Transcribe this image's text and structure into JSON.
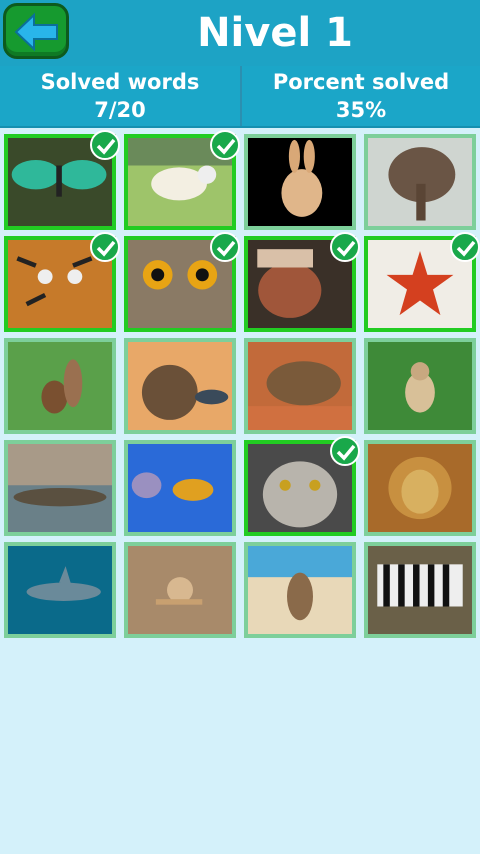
{
  "header": {
    "title": "Nivel 1",
    "back_icon": "arrow-left-icon"
  },
  "stats": {
    "solved_label": "Solved words",
    "solved_value": "7/20",
    "percent_label": "Porcent solved",
    "percent_value": "35%"
  },
  "colors": {
    "header_bg": "#1da3c5",
    "page_bg": "#d4f1fa",
    "solved_border": "#22cc22",
    "unsolved_border": "#7dcf9a",
    "check_bg": "#19a84a"
  },
  "tiles": [
    {
      "name": "butterfly",
      "solved": true
    },
    {
      "name": "sheep",
      "solved": true
    },
    {
      "name": "rabbit",
      "solved": false
    },
    {
      "name": "elephant",
      "solved": false
    },
    {
      "name": "tiger",
      "solved": true
    },
    {
      "name": "owl",
      "solved": true
    },
    {
      "name": "horse",
      "solved": true
    },
    {
      "name": "starfish",
      "solved": true
    },
    {
      "name": "squirrel",
      "solved": false
    },
    {
      "name": "duck",
      "solved": false
    },
    {
      "name": "tortoise",
      "solved": false
    },
    {
      "name": "monkey",
      "solved": false
    },
    {
      "name": "crocodile",
      "solved": false
    },
    {
      "name": "bee",
      "solved": false
    },
    {
      "name": "cat",
      "solved": true
    },
    {
      "name": "lion",
      "solved": false
    },
    {
      "name": "shark",
      "solved": false
    },
    {
      "name": "snail",
      "solved": false
    },
    {
      "name": "kangaroo",
      "solved": false
    },
    {
      "name": "zebra",
      "solved": false
    }
  ]
}
